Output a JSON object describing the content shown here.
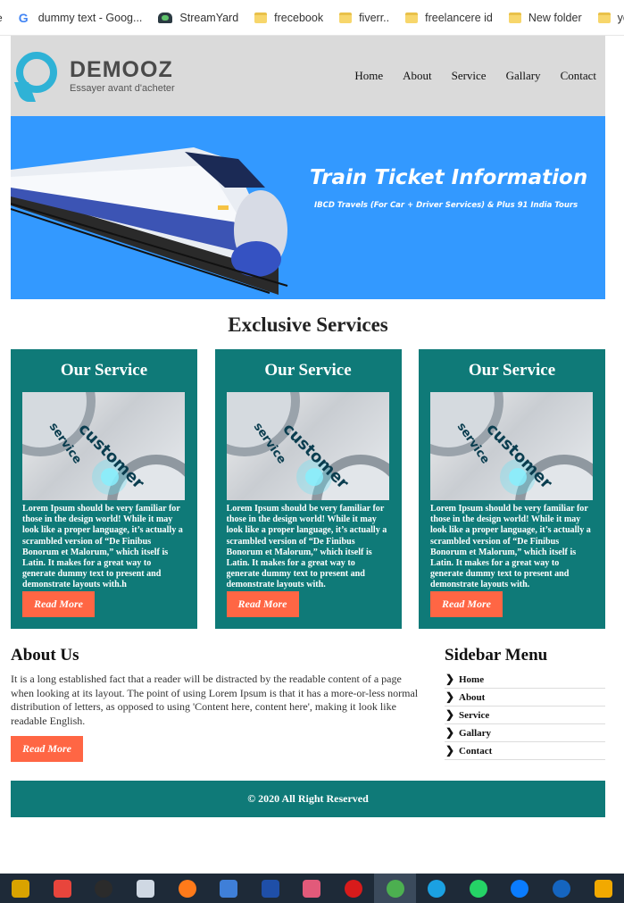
{
  "bookmarks": [
    {
      "label": "dummy text - Goog...",
      "icon": "google-icon"
    },
    {
      "label": "StreamYard",
      "icon": "streamyard-icon"
    },
    {
      "label": "frecebook",
      "icon": "folder-icon"
    },
    {
      "label": "fiverr..",
      "icon": "folder-icon"
    },
    {
      "label": "freelancere id",
      "icon": "folder-icon"
    },
    {
      "label": "New folder",
      "icon": "folder-icon"
    },
    {
      "label": "yout",
      "icon": "folder-icon"
    }
  ],
  "header": {
    "brand": "DEMOOZ",
    "tagline": "Essayer avant d'acheter",
    "nav": [
      "Home",
      "About",
      "Service",
      "Gallary",
      "Contact"
    ]
  },
  "banner": {
    "title": "Train Ticket Information",
    "subtitle": "IBCD Travels (For Car + Driver Services) & Plus 91 India Tours"
  },
  "services": {
    "title": "Exclusive Services",
    "cards": [
      {
        "title": "Our Service",
        "img_word1": "customer",
        "img_word2": "service",
        "text": "Lorem Ipsum should be very familiar for those in the design world! While it may look like a proper language, it’s actually a scrambled version of “De Finibus Bonorum et Malorum,” which itself is Latin. It makes for a great way to generate dummy text to present and demonstrate layouts with.h",
        "button": "Read More"
      },
      {
        "title": "Our Service",
        "img_word1": "customer",
        "img_word2": "service",
        "text": "Lorem Ipsum should be very familiar for those in the design world! While it may look like a proper language, it’s actually a scrambled version of “De Finibus Bonorum et Malorum,” which itself is Latin. It makes for a great way to generate dummy text to present and demonstrate layouts with.",
        "button": "Read More"
      },
      {
        "title": "Our Service",
        "img_word1": "customer",
        "img_word2": "service",
        "text": "Lorem Ipsum should be very familiar for those in the design world! While it may look like a proper language, it’s actually a scrambled version of “De Finibus Bonorum et Malorum,” which itself is Latin. It makes for a great way to generate dummy text to present and demonstrate layouts with.",
        "button": "Read More"
      }
    ]
  },
  "about": {
    "title": "About Us",
    "text": "It is a long established fact that a reader will be distracted by the readable content of a page when looking at its layout. The point of using Lorem Ipsum is that it has a more-or-less normal distribution of letters, as opposed to using 'Content here, content here', making it look like readable English.",
    "button": "Read More"
  },
  "sidebar": {
    "title": "Sidebar Menu",
    "items": [
      "Home",
      "About",
      "Service",
      "Gallary",
      "Contact"
    ]
  },
  "footer": {
    "text": "© 2020 All Right Reserved"
  },
  "taskbar": {
    "icons": [
      "app-icon",
      "git-icon",
      "obs-icon",
      "box-icon",
      "firefox-icon",
      "mail-icon",
      "app-icon",
      "paint-icon",
      "opera-icon",
      "chrome-icon",
      "skype-icon",
      "whatsapp-icon",
      "messenger-icon",
      "imo-icon",
      "app-icon"
    ],
    "colors": [
      "#d9a300",
      "#e8453c",
      "#2b2b2b",
      "#cfd8e3",
      "#ff7a1a",
      "#3f7fd8",
      "#1f4fa8",
      "#e25a7a",
      "#d81b1b",
      "#4caf50",
      "#1ba1e2",
      "#25d366",
      "#0a7cff",
      "#1565c0",
      "#f2a900"
    ]
  }
}
